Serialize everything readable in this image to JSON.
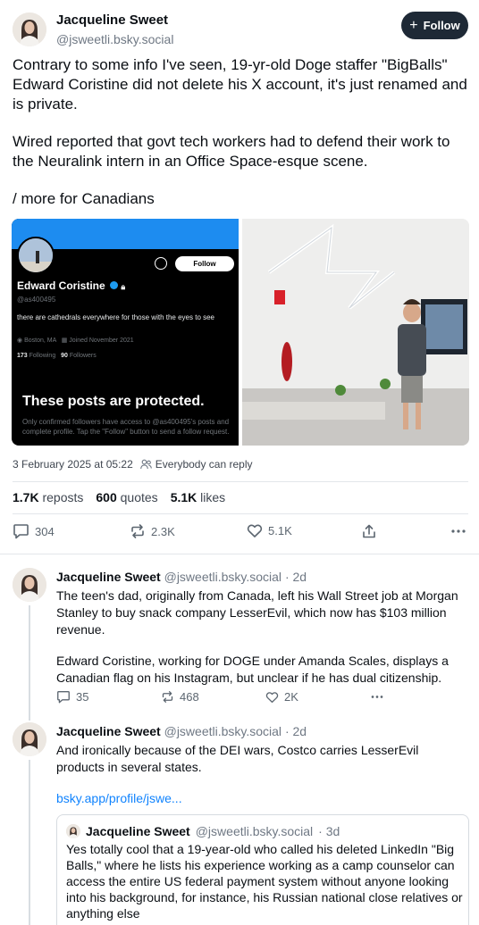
{
  "main_post": {
    "author_name": "Jacqueline Sweet",
    "author_handle": "@jsweetli.bsky.social",
    "follow_label": "Follow",
    "paragraphs": [
      "Contrary to some info I've seen, 19-yr-old Doge staffer \"BigBalls\" Edward Coristine did not delete his X account, it's just renamed and is private.",
      "Wired reported that govt tech workers had to defend their work to the Neuralink intern in an Office Space-esque scene.",
      "/ more for Canadians"
    ],
    "timestamp": "3 February 2025 at 05:22",
    "reply_setting": "Everybody can reply",
    "reposts_count": "1.7K",
    "reposts_label": "reposts",
    "quotes_count": "600",
    "quotes_label": "quotes",
    "likes_count": "5.1K",
    "likes_label": "likes",
    "reply_action_count": "304",
    "repost_action_count": "2.3K",
    "like_action_count": "5.1K"
  },
  "embedded_profile": {
    "name": "Edward Coristine",
    "handle": "@as400495",
    "follow_label": "Follow",
    "bio": "there are cathedrals everywhere for those with the eyes to see",
    "location": "Boston, MA",
    "joined": "Joined November 2021",
    "following_count": "173",
    "following_label": "Following",
    "followers_count": "90",
    "followers_label": "Followers",
    "protected_title": "These posts are protected.",
    "protected_sub": "Only confirmed followers have access to @as400495's posts and complete profile. Tap the \"Follow\" button to send a follow request."
  },
  "replies": [
    {
      "author_name": "Jacqueline Sweet",
      "author_handle": "@jsweetli.bsky.social",
      "age": "· 2d",
      "paragraphs": [
        "The teen's dad, originally from Canada, left his Wall Street job at Morgan Stanley to buy snack company LesserEvil, which now has $103 million revenue.",
        "Edward Coristine, working for DOGE under Amanda Scales, displays a Canadian flag on his Instagram, but unclear if he has dual citizenship."
      ],
      "reply_count": "35",
      "repost_count": "468",
      "like_count": "2K"
    },
    {
      "author_name": "Jacqueline Sweet",
      "author_handle": "@jsweetli.bsky.social",
      "age": "· 2d",
      "paragraphs": [
        "And ironically because of the DEI wars, Costco carries LesserEvil products in several states."
      ],
      "link": "bsky.app/profile/jswe..."
    }
  ],
  "quote_post": {
    "author_name": "Jacqueline Sweet",
    "author_handle": "@jsweetli.bsky.social",
    "age": "· 3d",
    "text": "Yes totally cool that a 19-year-old who called his deleted LinkedIn \"Big Balls,\" where he lists his experience working as a camp counselor can access the entire US federal payment system without anyone looking into his background, for instance, his Russian national close relatives or anything else"
  },
  "colors": {
    "accent": "#1083fe",
    "follow_bg": "#1e2936",
    "muted": "#6f7884"
  }
}
